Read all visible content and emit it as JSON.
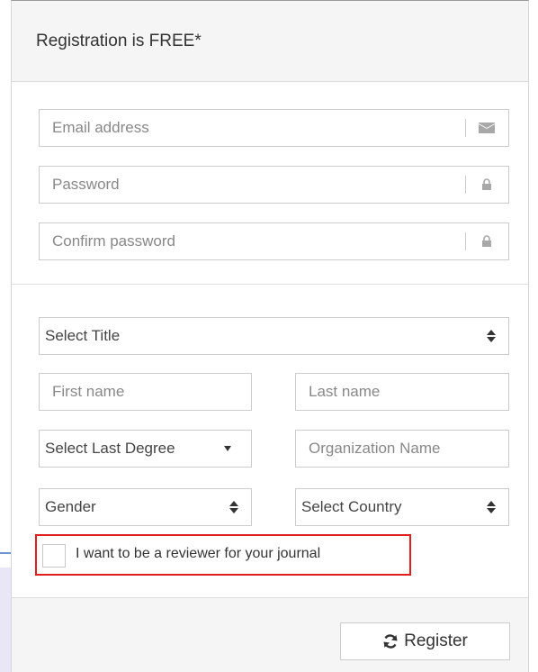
{
  "panel": {
    "title": "Registration is FREE*"
  },
  "account": {
    "email": {
      "placeholder": "Email address",
      "icon": "envelope-icon"
    },
    "password": {
      "placeholder": "Password",
      "icon": "lock-icon"
    },
    "confirm_password": {
      "placeholder": "Confirm password",
      "icon": "lock-icon"
    }
  },
  "profile": {
    "title_select": "Select Title",
    "first_name": "First name",
    "last_name": "Last name",
    "degree_select": "Select Last Degree",
    "organization": "Organization Name",
    "gender_select": "Gender",
    "country_select": "Select Country"
  },
  "reviewer": {
    "label": "I want to be a reviewer for your journal",
    "checked": false,
    "highlight_color": "#e02020"
  },
  "footer": {
    "register_label": "Register",
    "register_icon": "refresh-icon"
  },
  "annotation": {
    "arrow_color": "#3b6fc4"
  }
}
